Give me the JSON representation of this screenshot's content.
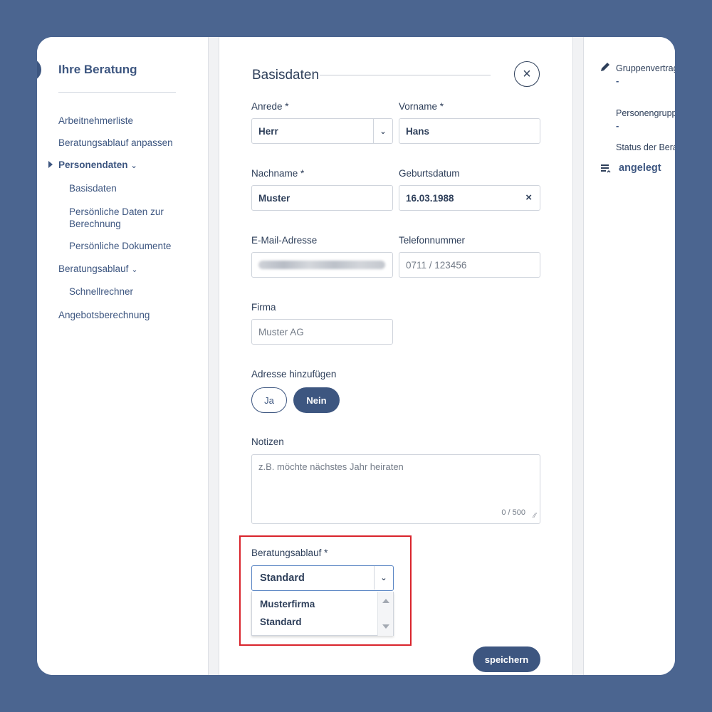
{
  "sidebar": {
    "title": "Ihre Beratung",
    "items": [
      {
        "label": "Arbeitnehmerliste"
      },
      {
        "label": "Beratungsablauf anpassen"
      },
      {
        "label": "Personendaten",
        "chevron": "⌄"
      },
      {
        "label": "Basisdaten"
      },
      {
        "label": "Persönliche Daten zur"
      },
      {
        "label": "Berechnung"
      },
      {
        "label": "Persönliche Dokumente"
      },
      {
        "label": "Beratungsablauf",
        "chevron": "⌄"
      },
      {
        "label": "Schnellrechner"
      },
      {
        "label": "Angebotsberechnung"
      }
    ]
  },
  "form": {
    "title": "Basisdaten",
    "close_icon": "×",
    "anrede": {
      "label": "Anrede *",
      "value": "Herr"
    },
    "vorname": {
      "label": "Vorname *",
      "value": "Hans"
    },
    "nachname": {
      "label": "Nachname *",
      "value": "Muster"
    },
    "geburtsdatum": {
      "label": "Geburtsdatum",
      "value": "16.03.1988",
      "clear_icon": "×"
    },
    "email": {
      "label": "E-Mail-Adresse"
    },
    "telefon": {
      "label": "Telefonnummer",
      "value": "0711 / 123456"
    },
    "firma": {
      "label": "Firma",
      "value": "Muster AG"
    },
    "adresse": {
      "label": "Adresse hinzufügen",
      "options": [
        "Ja",
        "Nein"
      ],
      "selected": "Nein"
    },
    "notizen": {
      "label": "Notizen",
      "placeholder": "z.B. möchte nächstes Jahr heiraten",
      "counter": "0 / 500"
    },
    "beratungsablauf": {
      "label": "Beratungsablauf *",
      "value": "Standard",
      "options": [
        "Musterfirma",
        "Standard"
      ]
    },
    "save_label": "speichern",
    "chevron": "⌄"
  },
  "right_panel": {
    "gruppenvertrag_label": "Gruppenvertrag",
    "gruppenvertrag_value": "-",
    "personengruppe_label": "Personengruppe",
    "personengruppe_value": "-",
    "status_label": "Status der Beratung",
    "status_value": "angelegt"
  },
  "colors": {
    "brand": "#3d5680",
    "background": "#4b6590",
    "highlight": "#d9242c"
  }
}
